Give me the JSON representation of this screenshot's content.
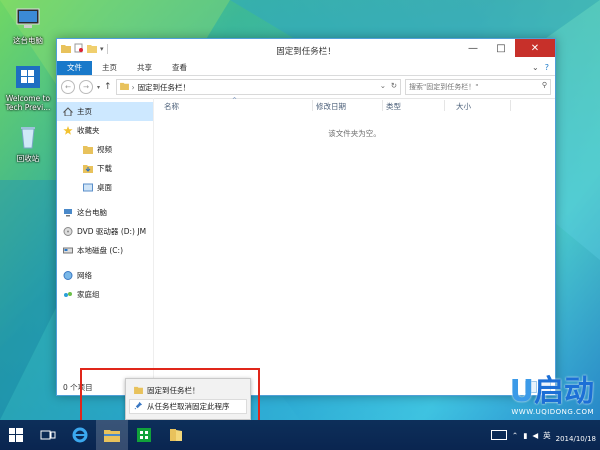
{
  "desktop": {
    "icons": [
      {
        "label": "这台电脑",
        "name": "desktop-icon-this-pc"
      },
      {
        "label": "Welcome to Tech Previ...",
        "name": "desktop-icon-welcome"
      },
      {
        "label": "回收站",
        "name": "desktop-icon-recycle-bin"
      }
    ]
  },
  "window": {
    "title": "固定到任务栏！",
    "controls": {
      "minimize": "—",
      "maximize": "□",
      "close": "✕"
    },
    "ribbon_tabs": [
      "文件",
      "主页",
      "共享",
      "查看"
    ],
    "address": "固定到任务栏！",
    "search_placeholder": "搜索\"固定到任务栏！\"",
    "nav_items": [
      {
        "label": "主页",
        "name": "nav-home",
        "selected": true,
        "indent": false
      },
      {
        "label": "收藏夹",
        "name": "nav-favorites",
        "indent": false
      },
      {
        "label": "视频",
        "name": "nav-videos",
        "indent": true
      },
      {
        "label": "下载",
        "name": "nav-downloads",
        "indent": true
      },
      {
        "label": "桌面",
        "name": "nav-desktop",
        "indent": true
      },
      {
        "label": "这台电脑",
        "name": "nav-this-pc",
        "indent": false
      },
      {
        "label": "DVD 驱动器 (D:) JM",
        "name": "nav-dvd-drive",
        "indent": false
      },
      {
        "label": "本地磁盘 (C:)",
        "name": "nav-local-disk",
        "indent": false
      },
      {
        "label": "网络",
        "name": "nav-network",
        "indent": false
      },
      {
        "label": "家庭组",
        "name": "nav-homegroup",
        "indent": false
      }
    ],
    "columns": [
      "名称",
      "修改日期",
      "类型",
      "大小"
    ],
    "empty_message": "该文件夹为空。",
    "status": "0 个项目"
  },
  "jumplist": {
    "items": [
      "固定到任务栏！",
      "从任务栏取消固定此程序"
    ]
  },
  "taskbar": {
    "clock_date": "2014/10/18",
    "ime": "英"
  },
  "watermark": {
    "brand": "启动",
    "url": "WWW.UQIDONG.COM"
  },
  "colors": {
    "accent": "#1979ca",
    "close": "#c7302a",
    "highlight_box": "#e0261a",
    "taskbar": "#0d2f5a"
  }
}
